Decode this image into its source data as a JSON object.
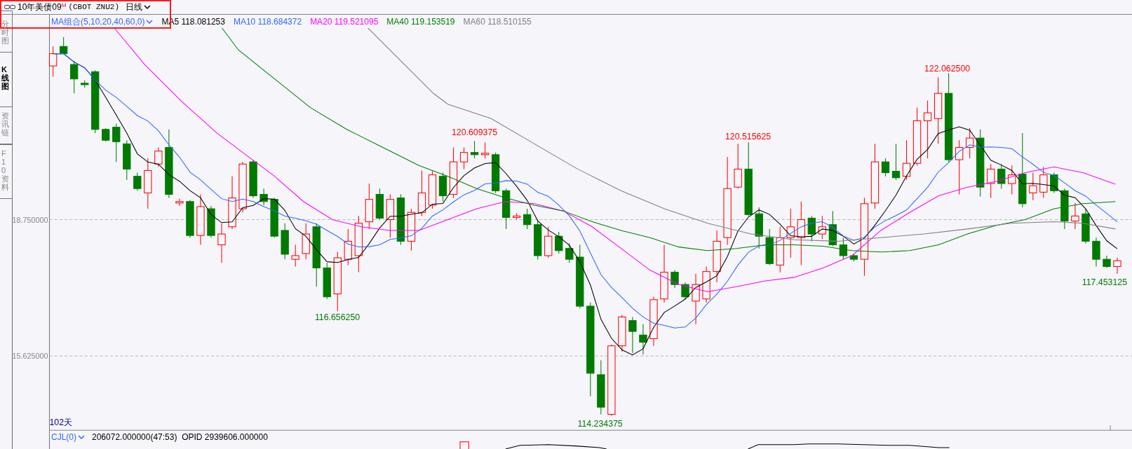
{
  "instrument": {
    "name": "10年美债09",
    "flag": "M",
    "code": "(CBOT ZNU2)",
    "period": "日线"
  },
  "side_tabs": [
    {
      "label": "分时图",
      "selected": false
    },
    {
      "label": "K线图",
      "selected": true
    },
    {
      "label": "资讯链",
      "selected": false
    },
    {
      "label": "F10资料",
      "selected": false
    }
  ],
  "chart": {
    "indicator": "MA组合(5,10,20,40,60,0)",
    "ma_readings": [
      {
        "label": "MA5 118.081253",
        "color": "#000000"
      },
      {
        "label": "MA10 118.684372",
        "color": "#3366ff"
      },
      {
        "label": "MA20 119.521095",
        "color": "#ff00ff"
      },
      {
        "label": "MA40 119.153519",
        "color": "#008000"
      },
      {
        "label": "MA60 118.510155",
        "color": "#808080"
      }
    ],
    "y_labels": [
      "18.750000",
      "15.625000"
    ],
    "price_marks": [
      {
        "text": "120.609375",
        "kind": "high"
      },
      {
        "text": "120.515625",
        "kind": "high"
      },
      {
        "text": "122.062500",
        "kind": "high"
      },
      {
        "text": "116.656250",
        "kind": "low"
      },
      {
        "text": "114.234375",
        "kind": "low"
      },
      {
        "text": "117.453125",
        "kind": "low"
      }
    ],
    "day_count": "102天"
  },
  "volume": {
    "indicator": "CJL(0)",
    "readings": "206072.000000(47:53)  OPID 2939606.000000"
  }
}
